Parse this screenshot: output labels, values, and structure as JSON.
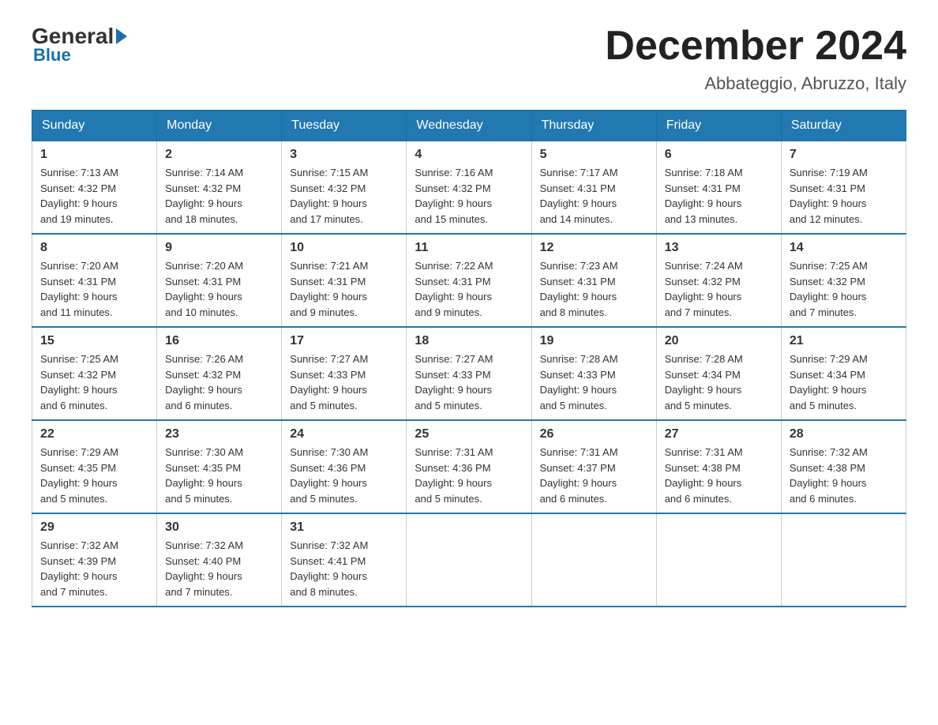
{
  "header": {
    "logo": {
      "general": "General",
      "blue": "Blue"
    },
    "title": "December 2024",
    "location": "Abbateggio, Abruzzo, Italy"
  },
  "days_of_week": [
    "Sunday",
    "Monday",
    "Tuesday",
    "Wednesday",
    "Thursday",
    "Friday",
    "Saturday"
  ],
  "weeks": [
    [
      {
        "day": "1",
        "sunrise": "7:13 AM",
        "sunset": "4:32 PM",
        "daylight": "9 hours and 19 minutes."
      },
      {
        "day": "2",
        "sunrise": "7:14 AM",
        "sunset": "4:32 PM",
        "daylight": "9 hours and 18 minutes."
      },
      {
        "day": "3",
        "sunrise": "7:15 AM",
        "sunset": "4:32 PM",
        "daylight": "9 hours and 17 minutes."
      },
      {
        "day": "4",
        "sunrise": "7:16 AM",
        "sunset": "4:32 PM",
        "daylight": "9 hours and 15 minutes."
      },
      {
        "day": "5",
        "sunrise": "7:17 AM",
        "sunset": "4:31 PM",
        "daylight": "9 hours and 14 minutes."
      },
      {
        "day": "6",
        "sunrise": "7:18 AM",
        "sunset": "4:31 PM",
        "daylight": "9 hours and 13 minutes."
      },
      {
        "day": "7",
        "sunrise": "7:19 AM",
        "sunset": "4:31 PM",
        "daylight": "9 hours and 12 minutes."
      }
    ],
    [
      {
        "day": "8",
        "sunrise": "7:20 AM",
        "sunset": "4:31 PM",
        "daylight": "9 hours and 11 minutes."
      },
      {
        "day": "9",
        "sunrise": "7:20 AM",
        "sunset": "4:31 PM",
        "daylight": "9 hours and 10 minutes."
      },
      {
        "day": "10",
        "sunrise": "7:21 AM",
        "sunset": "4:31 PM",
        "daylight": "9 hours and 9 minutes."
      },
      {
        "day": "11",
        "sunrise": "7:22 AM",
        "sunset": "4:31 PM",
        "daylight": "9 hours and 9 minutes."
      },
      {
        "day": "12",
        "sunrise": "7:23 AM",
        "sunset": "4:31 PM",
        "daylight": "9 hours and 8 minutes."
      },
      {
        "day": "13",
        "sunrise": "7:24 AM",
        "sunset": "4:32 PM",
        "daylight": "9 hours and 7 minutes."
      },
      {
        "day": "14",
        "sunrise": "7:25 AM",
        "sunset": "4:32 PM",
        "daylight": "9 hours and 7 minutes."
      }
    ],
    [
      {
        "day": "15",
        "sunrise": "7:25 AM",
        "sunset": "4:32 PM",
        "daylight": "9 hours and 6 minutes."
      },
      {
        "day": "16",
        "sunrise": "7:26 AM",
        "sunset": "4:32 PM",
        "daylight": "9 hours and 6 minutes."
      },
      {
        "day": "17",
        "sunrise": "7:27 AM",
        "sunset": "4:33 PM",
        "daylight": "9 hours and 5 minutes."
      },
      {
        "day": "18",
        "sunrise": "7:27 AM",
        "sunset": "4:33 PM",
        "daylight": "9 hours and 5 minutes."
      },
      {
        "day": "19",
        "sunrise": "7:28 AM",
        "sunset": "4:33 PM",
        "daylight": "9 hours and 5 minutes."
      },
      {
        "day": "20",
        "sunrise": "7:28 AM",
        "sunset": "4:34 PM",
        "daylight": "9 hours and 5 minutes."
      },
      {
        "day": "21",
        "sunrise": "7:29 AM",
        "sunset": "4:34 PM",
        "daylight": "9 hours and 5 minutes."
      }
    ],
    [
      {
        "day": "22",
        "sunrise": "7:29 AM",
        "sunset": "4:35 PM",
        "daylight": "9 hours and 5 minutes."
      },
      {
        "day": "23",
        "sunrise": "7:30 AM",
        "sunset": "4:35 PM",
        "daylight": "9 hours and 5 minutes."
      },
      {
        "day": "24",
        "sunrise": "7:30 AM",
        "sunset": "4:36 PM",
        "daylight": "9 hours and 5 minutes."
      },
      {
        "day": "25",
        "sunrise": "7:31 AM",
        "sunset": "4:36 PM",
        "daylight": "9 hours and 5 minutes."
      },
      {
        "day": "26",
        "sunrise": "7:31 AM",
        "sunset": "4:37 PM",
        "daylight": "9 hours and 6 minutes."
      },
      {
        "day": "27",
        "sunrise": "7:31 AM",
        "sunset": "4:38 PM",
        "daylight": "9 hours and 6 minutes."
      },
      {
        "day": "28",
        "sunrise": "7:32 AM",
        "sunset": "4:38 PM",
        "daylight": "9 hours and 6 minutes."
      }
    ],
    [
      {
        "day": "29",
        "sunrise": "7:32 AM",
        "sunset": "4:39 PM",
        "daylight": "9 hours and 7 minutes."
      },
      {
        "day": "30",
        "sunrise": "7:32 AM",
        "sunset": "4:40 PM",
        "daylight": "9 hours and 7 minutes."
      },
      {
        "day": "31",
        "sunrise": "7:32 AM",
        "sunset": "4:41 PM",
        "daylight": "9 hours and 8 minutes."
      },
      null,
      null,
      null,
      null
    ]
  ],
  "labels": {
    "sunrise": "Sunrise: ",
    "sunset": "Sunset: ",
    "daylight": "Daylight: "
  }
}
